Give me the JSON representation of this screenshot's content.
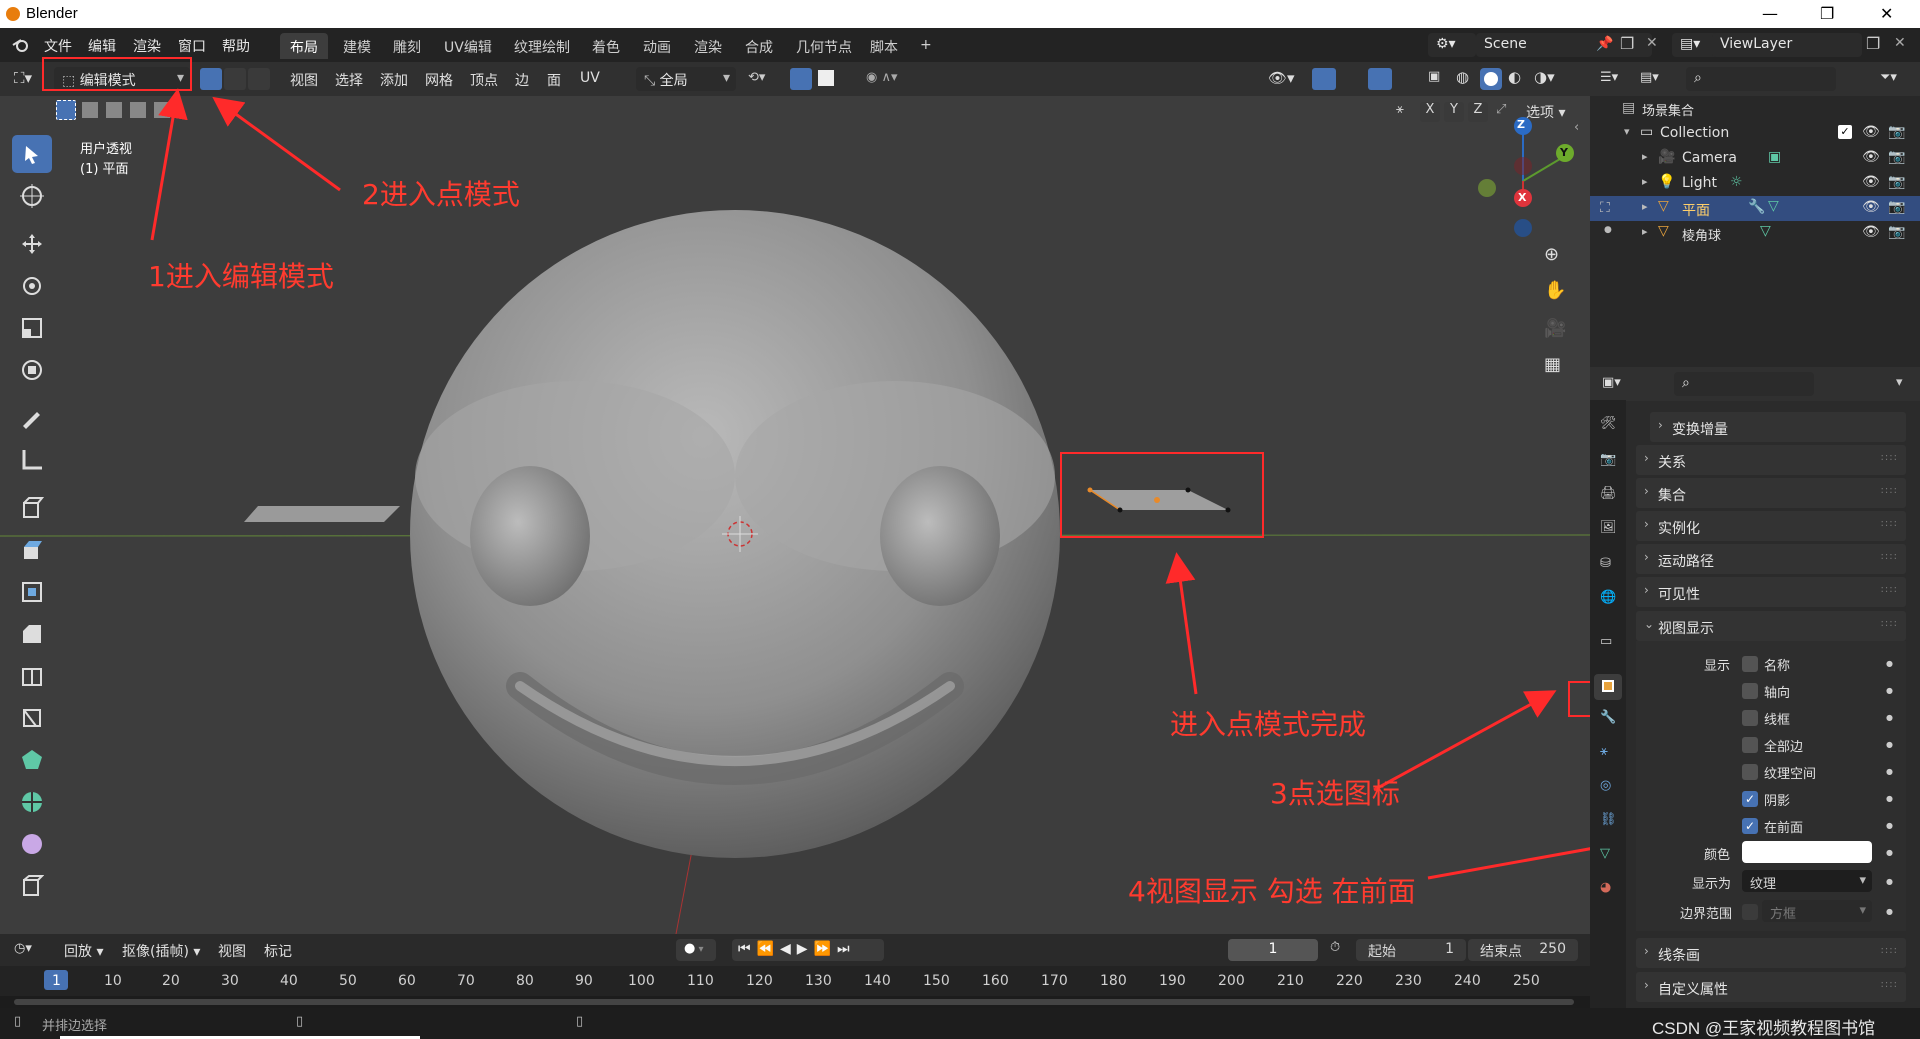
{
  "window": {
    "title": "Blender"
  },
  "menu": [
    "文件",
    "编辑",
    "渲染",
    "窗口",
    "帮助"
  ],
  "workspaces": [
    "布局",
    "建模",
    "雕刻",
    "UV编辑",
    "纹理绘制",
    "着色",
    "动画",
    "渲染",
    "合成",
    "几何节点",
    "脚本",
    "+"
  ],
  "scene": {
    "name": "Scene",
    "view_layer": "ViewLayer"
  },
  "viewport_header": {
    "mode": "编辑模式",
    "menus": [
      "视图",
      "选择",
      "添加",
      "网格",
      "顶点",
      "边",
      "面",
      "UV"
    ],
    "orientation": "全局",
    "axes": [
      "X",
      "Y",
      "Z"
    ],
    "options": "选项"
  },
  "viewport": {
    "view_name": "用户透视",
    "object_label": "(1) 平面",
    "gizmo": {
      "z": "Z",
      "y": "Y",
      "x": "X"
    }
  },
  "annotations": {
    "a1": "1进入编辑模式",
    "a2": "2进入点模式",
    "a3": "3点选图标",
    "a4": "4视图显示 勾选 在前面",
    "a5": "进入点模式完成"
  },
  "outliner": {
    "root": "场景集合",
    "items": [
      {
        "label": "Collection"
      },
      {
        "label": "Camera"
      },
      {
        "label": "Light"
      },
      {
        "label": "平面"
      },
      {
        "label": "棱角球"
      }
    ]
  },
  "properties": {
    "panels": [
      "变换增量",
      "关系",
      "集合",
      "实例化",
      "运动路径",
      "可见性",
      "视图显示"
    ],
    "viewport_display": {
      "show_label": "显示",
      "checks": [
        {
          "label": "名称",
          "checked": false
        },
        {
          "label": "轴向",
          "checked": false
        },
        {
          "label": "线框",
          "checked": false
        },
        {
          "label": "全部边",
          "checked": false
        },
        {
          "label": "纹理空间",
          "checked": false
        },
        {
          "label": "阴影",
          "checked": true
        },
        {
          "label": "在前面",
          "checked": true
        }
      ],
      "color_label": "颜色",
      "display_as_label": "显示为",
      "display_as_value": "纹理",
      "bounds_label": "边界范围",
      "bounds_value": "方框"
    },
    "bottom_panels": [
      "线条画",
      "自定义属性"
    ]
  },
  "timeline": {
    "menus": [
      "回放",
      "抠像(插帧)",
      "视图",
      "标记"
    ],
    "current_frame": "1",
    "start_label": "起始",
    "start": "1",
    "end_label": "结束点",
    "end": "250",
    "ticks": [
      "1",
      "10",
      "20",
      "30",
      "40",
      "50",
      "60",
      "70",
      "80",
      "90",
      "100",
      "110",
      "120",
      "130",
      "140",
      "150",
      "160",
      "170",
      "180",
      "190",
      "200",
      "210",
      "220",
      "230",
      "240",
      "250"
    ]
  },
  "status": {
    "left": "并排边选择",
    "watermark": "CSDN @王家视频教程图书馆"
  },
  "colors": {
    "accent": "#4772b3",
    "annotation": "#ff2a2a",
    "selected_row": "#334d80",
    "object_orange": "#e8a33d"
  }
}
